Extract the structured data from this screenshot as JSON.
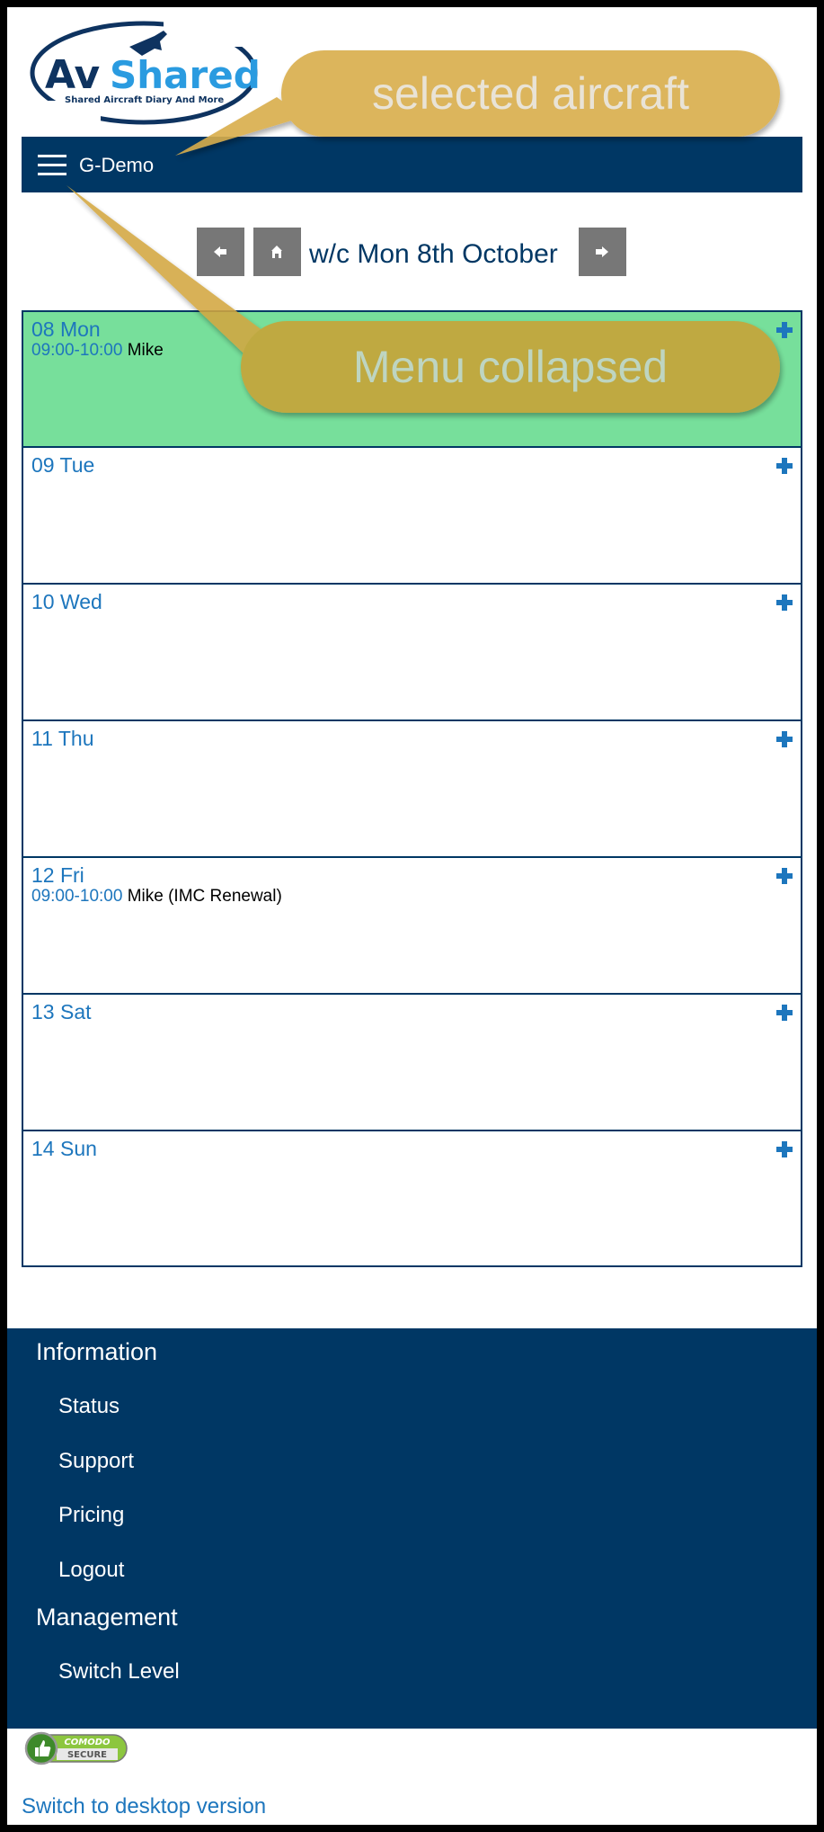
{
  "app": {
    "logo_title": "AvShared",
    "logo_tagline": "Shared Aircraft Diary And More"
  },
  "navbar": {
    "menu_icon": "hamburger-icon",
    "selected_aircraft": "G-Demo"
  },
  "week_nav": {
    "prev_icon": "arrow-left-icon",
    "home_icon": "home-icon",
    "next_icon": "arrow-right-icon",
    "title": "w/c Mon 8th October"
  },
  "days": [
    {
      "label": "08 Mon",
      "today": true,
      "bookings": [
        {
          "time": "09:00-10:00",
          "who": "Mike"
        }
      ]
    },
    {
      "label": "09 Tue",
      "today": false,
      "bookings": []
    },
    {
      "label": "10 Wed",
      "today": false,
      "bookings": []
    },
    {
      "label": "11 Thu",
      "today": false,
      "bookings": []
    },
    {
      "label": "12 Fri",
      "today": false,
      "bookings": [
        {
          "time": "09:00-10:00",
          "who": "Mike (IMC Renewal)"
        }
      ]
    },
    {
      "label": "13 Sat",
      "today": false,
      "bookings": []
    },
    {
      "label": "14 Sun",
      "today": false,
      "bookings": []
    }
  ],
  "footer_menu": {
    "sections": [
      {
        "heading": "Information",
        "items": [
          "Status",
          "Support",
          "Pricing",
          "Logout"
        ]
      },
      {
        "heading": "Management",
        "items": [
          "Switch Level"
        ]
      }
    ]
  },
  "badge": {
    "line1": "COMODO",
    "line2": "SECURE"
  },
  "desktop_link": "Switch to desktop version",
  "annotations": [
    {
      "text": "selected aircraft"
    },
    {
      "text": "Menu collapsed"
    }
  ],
  "colors": {
    "navy": "#003764",
    "accent_blue": "#1d76bd",
    "today_green": "#77df9b",
    "button_grey": "#777777",
    "callout_gold": "#dcb55a"
  }
}
